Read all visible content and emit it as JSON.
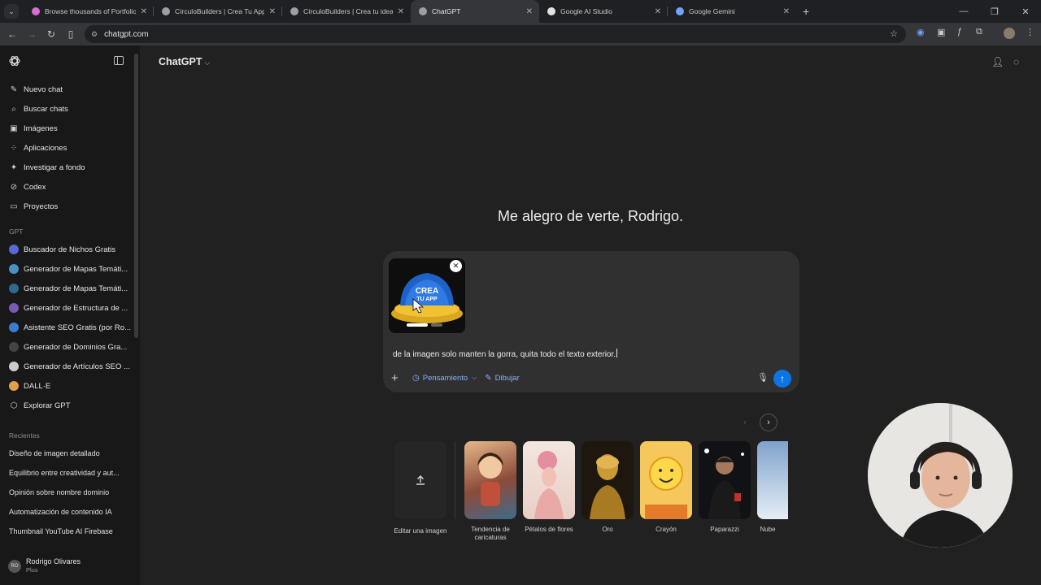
{
  "browser": {
    "tabs": [
      {
        "title": "Browse thousands of Portfolio",
        "color": "#d86dd0"
      },
      {
        "title": "CírculoBuilders | Crea Tu App c",
        "color": "#9aa0a6"
      },
      {
        "title": "CírculoBuilders | Crea tu idea h",
        "color": "#9aa0a6"
      },
      {
        "title": "ChatGPT",
        "color": "#9aa0a6"
      },
      {
        "title": "Google AI Studio",
        "color": "#e3e3e3"
      },
      {
        "title": "Google Gemini",
        "color": "#6ea6ff"
      }
    ],
    "url": "chatgpt.com"
  },
  "sidebar": {
    "nav": [
      {
        "label": "Nuevo chat",
        "icon": "✎"
      },
      {
        "label": "Buscar chats",
        "icon": "⌕"
      },
      {
        "label": "Imágenes",
        "icon": "▣"
      },
      {
        "label": "Aplicaciones",
        "icon": "⁘"
      },
      {
        "label": "Investigar a fondo",
        "icon": "✦"
      },
      {
        "label": "Codex",
        "icon": "⊘"
      },
      {
        "label": "Proyectos",
        "icon": "▭"
      }
    ],
    "gpt_heading": "GPT",
    "gpts": [
      {
        "label": "Buscador de Nichos Gratis",
        "color": "#5a67d8"
      },
      {
        "label": "Generador de Mapas Temáti...",
        "color": "#4a90c2"
      },
      {
        "label": "Generador de Mapas Temáti...",
        "color": "#2e6a8f"
      },
      {
        "label": "Generador de Estructura de ...",
        "color": "#7a5ab0"
      },
      {
        "label": "Asistente SEO Gratis (por Ro...",
        "color": "#3b7bd1"
      },
      {
        "label": "Generador de Dominios Gra...",
        "color": "#444444"
      },
      {
        "label": "Generador de Artículos SEO ...",
        "color": "#cccccc"
      },
      {
        "label": "DALL·E",
        "color": "#e0a04a"
      }
    ],
    "explore": {
      "label": "Explorar GPT",
      "icon": "⬡"
    },
    "recent_heading": "Recientes",
    "recents": [
      "Diseño de imagen detallado",
      "Equilibrio entre creatividad y aut...",
      "Opinión sobre nombre dominio",
      "Automatización de contenido IA",
      "Thumbnail YouTube AI Firebase"
    ],
    "user": {
      "name": "Rodrigo Olivares",
      "plan": "Plus",
      "initials": "RO"
    }
  },
  "main": {
    "model": "ChatGPT",
    "greeting": "Me alegro de verte, Rodrigo.",
    "composer": {
      "prompt": "de la imagen solo manten la gorra, quita todo el texto exterior.",
      "thinking_label": "Pensamiento",
      "draw_label": "Dibujar",
      "attachment": {
        "line1": "CREA",
        "line2": "TU APP"
      }
    },
    "styles": [
      {
        "label": "Editar una imagen"
      },
      {
        "label": "Tendencia de caricaturas"
      },
      {
        "label": "Pétalos de flores"
      },
      {
        "label": "Oro"
      },
      {
        "label": "Crayón"
      },
      {
        "label": "Paparazzi"
      },
      {
        "label": "Nube"
      }
    ]
  },
  "colors": {
    "accent": "#0b75e6",
    "link": "#85b4ff",
    "sidebar": "#181818",
    "main": "#212121"
  }
}
